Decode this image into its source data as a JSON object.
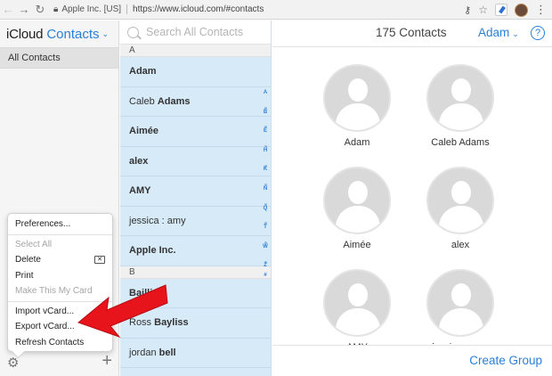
{
  "browser": {
    "site_identity": "Apple Inc. [US]",
    "url": "https://www.icloud.com/#contacts"
  },
  "sidebar": {
    "brand": "iCloud",
    "app_name": "Contacts",
    "groups": [
      {
        "label": "All Contacts"
      }
    ]
  },
  "menu": {
    "items": [
      {
        "label": "Preferences...",
        "enabled": true
      },
      {
        "label": "Select All",
        "enabled": false
      },
      {
        "label": "Delete",
        "enabled": true,
        "shortcut_icon": "delete-key-icon"
      },
      {
        "label": "Print",
        "enabled": true
      },
      {
        "label": "Make This My Card",
        "enabled": false
      },
      {
        "label": "Import vCard...",
        "enabled": true
      },
      {
        "label": "Export vCard...",
        "enabled": true
      },
      {
        "label": "Refresh Contacts",
        "enabled": true
      }
    ]
  },
  "search": {
    "placeholder": "Search All Contacts"
  },
  "list": {
    "sections": [
      {
        "letter": "A",
        "contacts": [
          {
            "first": "Adam",
            "last": ""
          },
          {
            "first": "Caleb",
            "last": "Adams"
          },
          {
            "first": "Aimée",
            "last": ""
          },
          {
            "first": "alex",
            "last": ""
          },
          {
            "first": "AMY",
            "last": ""
          },
          {
            "first": "jessica : amy",
            "last": ""
          },
          {
            "first": "Apple Inc.",
            "last": ""
          }
        ]
      },
      {
        "letter": "B",
        "contacts": [
          {
            "first": "",
            "last": "Baillie"
          },
          {
            "first": "Ross",
            "last": "Bayliss"
          },
          {
            "first": "jordan",
            "last": "bell"
          }
        ]
      }
    ],
    "index": [
      "A",
      "•",
      "B",
      "•",
      "E",
      "•",
      "H",
      "•",
      "K",
      "•",
      "N",
      "•",
      "Q",
      "•",
      "T",
      "•",
      "W",
      "•",
      "Z",
      "#"
    ]
  },
  "detail": {
    "count": "175 Contacts",
    "user": "Adam",
    "cards": [
      "Adam",
      "Caleb Adams",
      "Aimée",
      "alex",
      "AMY",
      "jessica : amy"
    ],
    "create_group": "Create Group"
  },
  "colors": {
    "accent": "#2b7fd6",
    "list_bg": "#d7eaf8",
    "annotation_arrow": "#e8141b"
  }
}
